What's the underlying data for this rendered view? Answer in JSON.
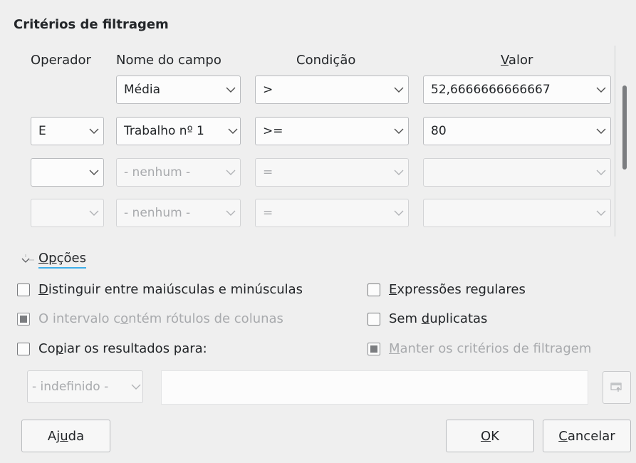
{
  "dialog": {
    "section_title": "Critérios de filtragem",
    "headers": {
      "operator": "Operador",
      "field_name": "Nome do campo",
      "condition": "Condição",
      "value_prefix": "",
      "value_accel": "V",
      "value_rest": "alor"
    },
    "rows": [
      {
        "operator": "",
        "field": "Média",
        "condition": ">",
        "value": "52,6666666666667"
      },
      {
        "operator": "E",
        "field": "Trabalho nº 1",
        "condition": ">=",
        "value": "80"
      },
      {
        "operator": "",
        "field": "- nenhum -",
        "condition": "=",
        "value": ""
      },
      {
        "operator": "",
        "field": "- nenhum -",
        "condition": "=",
        "value": ""
      }
    ],
    "options": {
      "label_prefix": "",
      "label_accel": "Op",
      "label_rest": "ções",
      "case_sensitive": {
        "accel": "D",
        "rest": "istinguir entre maiúsculas e minúsculas",
        "checked": false
      },
      "contains_headers": {
        "pre": "O intervalo c",
        "accel": "o",
        "rest": "ntém rótulos de colunas",
        "checked": true
      },
      "copy_results": {
        "pre": "Co",
        "accel": "p",
        "rest": "iar os resultados para:",
        "checked": false
      },
      "regex": {
        "accel": "E",
        "rest": "xpressões regulares",
        "checked": false
      },
      "no_duplicates": {
        "pre": "Sem ",
        "accel": "d",
        "rest": "uplicatas",
        "checked": false
      },
      "keep_criteria": {
        "accel": "M",
        "rest": "anter os critérios de filtragem",
        "checked": true
      },
      "target_select": "- indefinido -"
    },
    "buttons": {
      "help_pre": "Aj",
      "help_accel": "u",
      "help_rest": "da",
      "ok_accel": "O",
      "ok_rest": "K",
      "cancel_accel": "C",
      "cancel_rest": "ancelar"
    }
  }
}
